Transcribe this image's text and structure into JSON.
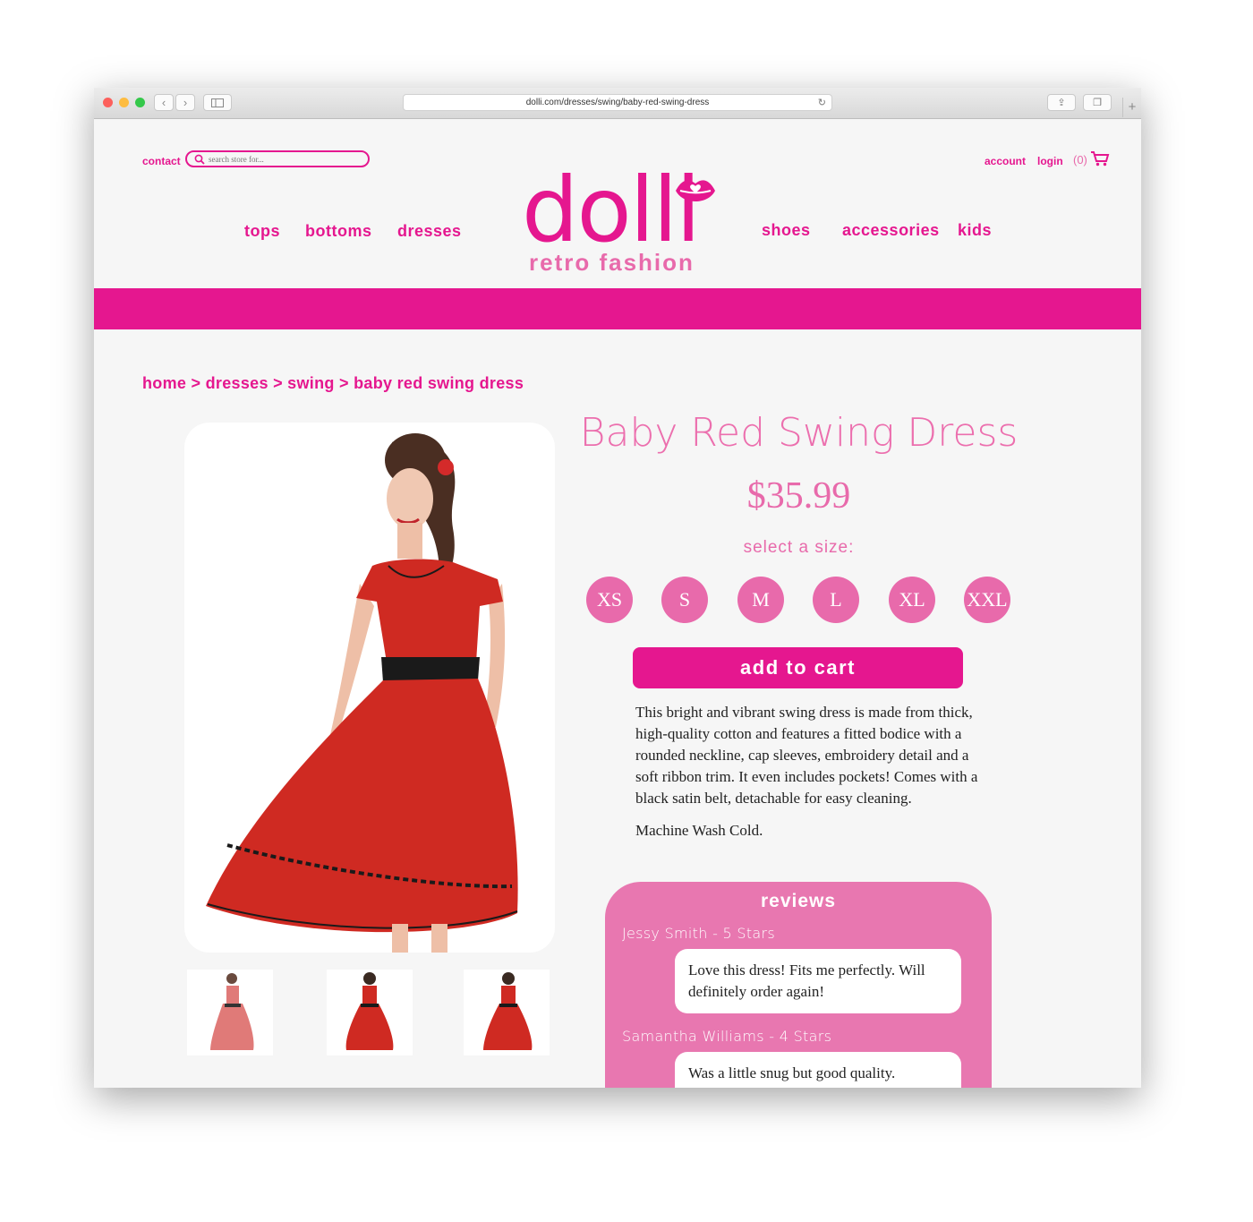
{
  "browser": {
    "url": "dolli.com/dresses/swing/baby-red-swing-dress"
  },
  "header": {
    "contact": "contact",
    "search_placeholder": "search store for...",
    "account": "account",
    "login": "login",
    "cart_count": "(0)",
    "nav_left": [
      "tops",
      "bottoms",
      "dresses"
    ],
    "nav_right": [
      "shoes",
      "accessories",
      "kids"
    ],
    "logo_word": "dolli",
    "logo_tagline": "retro fashion"
  },
  "breadcrumb": "home > dresses > swing > baby red swing dress",
  "product": {
    "title": "Baby Red Swing Dress",
    "price": "$35.99",
    "size_label": "select a size:",
    "sizes": [
      "XS",
      "S",
      "M",
      "L",
      "XL",
      "XXL"
    ],
    "add_to_cart": "add to cart",
    "description": "This bright and vibrant swing dress is made from thick, high-quality cotton and features a fitted bodice with a rounded neckline, cap sleeves, embroidery detail and a soft ribbon trim. It even includes pockets! Comes with a black satin belt, detachable for easy cleaning.",
    "care": "Machine Wash Cold."
  },
  "reviews": {
    "title": "reviews",
    "items": [
      {
        "author": "Jessy Smith - 5 Stars",
        "text": "Love this dress! Fits me perfectly. Will definitely order again!"
      },
      {
        "author": "Samantha Williams - 4 Stars",
        "text": "Was a little snug but good quality."
      }
    ]
  },
  "colors": {
    "brand": "#e5178f",
    "brand_light": "#e86aab",
    "dress_red": "#cf2a22"
  }
}
